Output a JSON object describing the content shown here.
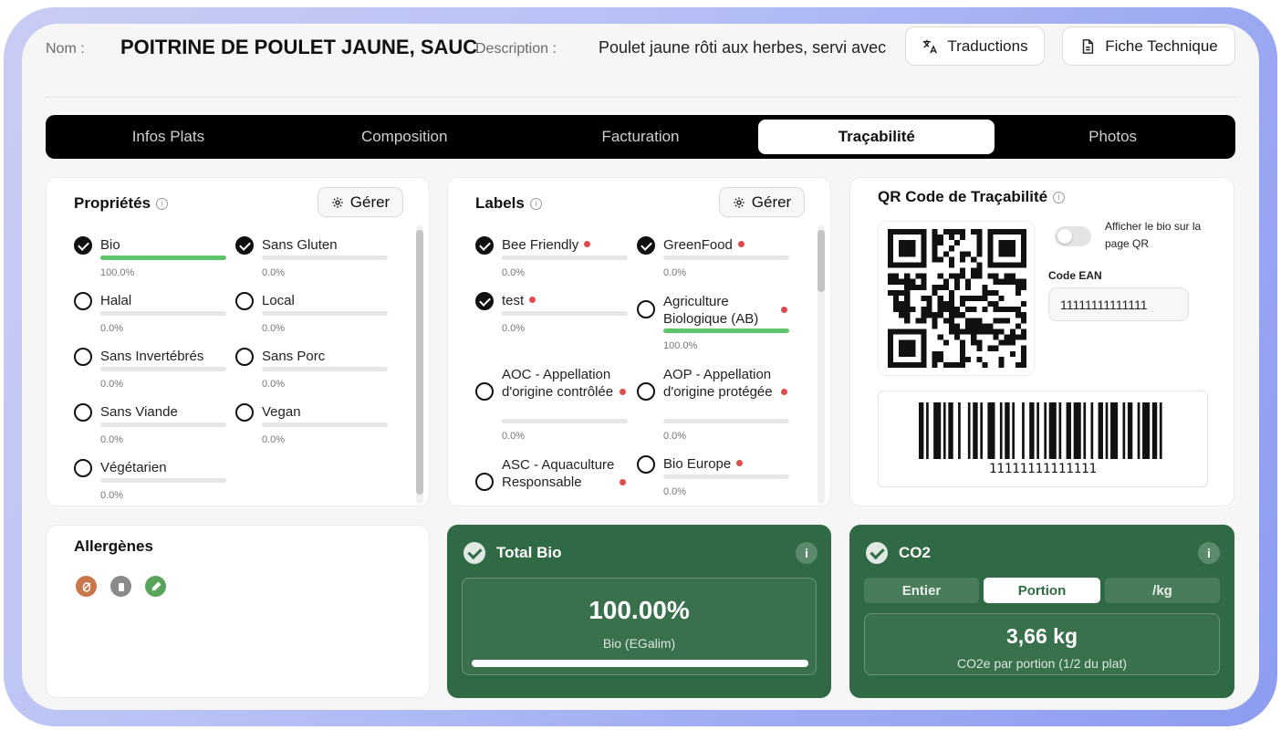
{
  "header": {
    "nom_label": "Nom :",
    "nom_value": "POITRINE DE POULET JAUNE, SAUC",
    "description_label": "Description :",
    "description_value": "Poulet jaune rôti aux herbes, servi avec",
    "traductions_button": "Traductions",
    "fiche_button": "Fiche Technique"
  },
  "tabs": [
    "Infos Plats",
    "Composition",
    "Facturation",
    "Traçabilité",
    "Photos"
  ],
  "active_tab": "Traçabilité",
  "proprietes": {
    "title": "Propriétés",
    "manage_button": "Gérer",
    "items": [
      {
        "label": "Bio",
        "checked": true,
        "pct": "100.0%",
        "fill": 1.0,
        "dot": true
      },
      {
        "label": "Sans Gluten",
        "checked": true,
        "pct": "0.0%",
        "fill": 0,
        "dot": true
      },
      {
        "label": "Halal",
        "checked": false,
        "pct": "0.0%",
        "fill": 0,
        "dot": false
      },
      {
        "label": "Local",
        "checked": false,
        "pct": "0.0%",
        "fill": 0,
        "dot": false
      },
      {
        "label": "Sans Invertébrés",
        "checked": false,
        "pct": "0.0%",
        "fill": 0,
        "dot": false
      },
      {
        "label": "Sans Porc",
        "checked": false,
        "pct": "0.0%",
        "fill": 0,
        "dot": false
      },
      {
        "label": "Sans Viande",
        "checked": false,
        "pct": "0.0%",
        "fill": 0,
        "dot": false
      },
      {
        "label": "Vegan",
        "checked": false,
        "pct": "0.0%",
        "fill": 0,
        "dot": false
      },
      {
        "label": "Végétarien",
        "checked": false,
        "pct": "0.0%",
        "fill": 0,
        "dot": false
      }
    ]
  },
  "labels": {
    "title": "Labels",
    "manage_button": "Gérer",
    "items": [
      {
        "label": "Bee Friendly",
        "checked": true,
        "pct": "0.0%",
        "fill": 0,
        "dot": true
      },
      {
        "label": "GreenFood",
        "checked": true,
        "pct": "0.0%",
        "fill": 0,
        "dot": true
      },
      {
        "label": "test",
        "checked": true,
        "pct": "0.0%",
        "fill": 0,
        "dot": true
      },
      {
        "label": "Agriculture Biologique (AB)",
        "checked": false,
        "pct": "100.0%",
        "fill": 1.0,
        "dot": true
      },
      {
        "label": "AOC - Appellation d'origine contrôlée",
        "checked": false,
        "pct": "0.0%",
        "fill": 0,
        "dot": true
      },
      {
        "label": "AOP - Appellation d'origine protégée",
        "checked": false,
        "pct": "0.0%",
        "fill": 0,
        "dot": true
      },
      {
        "label": "ASC - Aquaculture Responsable",
        "checked": false,
        "pct": "",
        "fill": 0,
        "dot": true
      },
      {
        "label": "Bio Europe",
        "checked": false,
        "pct": "0.0%",
        "fill": 0,
        "dot": true
      }
    ]
  },
  "qr": {
    "title": "QR Code de Traçabilité",
    "toggle_label": "Afficher le bio sur la page QR",
    "toggle_on": false,
    "ean_label": "Code EAN",
    "ean_value": "11111111111111",
    "barcode_text": "11111111111111"
  },
  "allergenes": {
    "title": "Allergènes",
    "icons": [
      {
        "name": "egg-allergen-icon",
        "color": "#c8764a"
      },
      {
        "name": "milk-allergen-icon",
        "color": "#8a8a8a"
      },
      {
        "name": "celery-allergen-icon",
        "color": "#5aa35a"
      }
    ]
  },
  "total_bio": {
    "title": "Total Bio",
    "value": "100.00%",
    "subtitle": "Bio (EGalim)",
    "progress": 1.0
  },
  "co2": {
    "title": "CO2",
    "segments": [
      "Entier",
      "Portion",
      "/kg"
    ],
    "active_segment": "Portion",
    "value": "3,66 kg",
    "subtitle": "CO2e par portion (1/2 du plat)"
  },
  "colors": {
    "accent_green": "#2f6a44",
    "progress_green": "#5fc46b",
    "alert_red": "#e24b4b"
  }
}
